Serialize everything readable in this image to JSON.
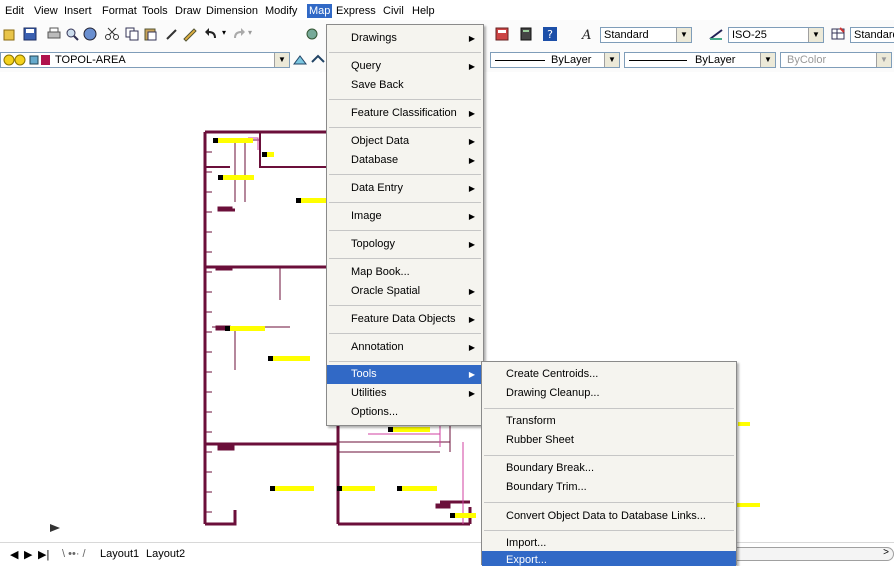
{
  "menubar": {
    "items": [
      {
        "label": "Edit"
      },
      {
        "label": "View"
      },
      {
        "label": "Insert"
      },
      {
        "label": "Format"
      },
      {
        "label": "Tools"
      },
      {
        "label": "Draw"
      },
      {
        "label": "Dimension"
      },
      {
        "label": "Modify"
      },
      {
        "label": "Map"
      },
      {
        "label": "Express"
      },
      {
        "label": "Civil"
      },
      {
        "label": "Help"
      }
    ]
  },
  "toolbar": {
    "text_style": "Standard",
    "dim_style": "ISO-25",
    "table_style": "Standard"
  },
  "layer_toolbar": {
    "current_layer": "TOPOL-AREA",
    "linetype": "ByLayer",
    "lineweight": "ByLayer",
    "plot_style": "ByColor"
  },
  "map_menu": {
    "items": [
      {
        "label": "Drawings",
        "submenu": true
      },
      {
        "label": "Query",
        "submenu": true
      },
      {
        "label": "Save Back",
        "submenu": false
      },
      {
        "label": "Feature Classification",
        "submenu": true
      },
      {
        "label": "Object Data",
        "submenu": true
      },
      {
        "label": "Database",
        "submenu": true
      },
      {
        "label": "Data Entry",
        "submenu": true
      },
      {
        "label": "Image",
        "submenu": true
      },
      {
        "label": "Topology",
        "submenu": true
      },
      {
        "label": "Map Book...",
        "submenu": false
      },
      {
        "label": "Oracle Spatial",
        "submenu": true
      },
      {
        "label": "Feature Data Objects",
        "submenu": true
      },
      {
        "label": "Annotation",
        "submenu": true
      },
      {
        "label": "Tools",
        "submenu": true,
        "highlighted": true
      },
      {
        "label": "Utilities",
        "submenu": true
      },
      {
        "label": "Options...",
        "submenu": false
      }
    ]
  },
  "tools_submenu": {
    "items": [
      {
        "label": "Create Centroids..."
      },
      {
        "label": "Drawing Cleanup..."
      },
      {
        "label": "Transform"
      },
      {
        "label": "Rubber Sheet"
      },
      {
        "label": "Boundary Break..."
      },
      {
        "label": "Boundary Trim..."
      },
      {
        "label": "Convert Object Data to Database Links..."
      },
      {
        "label": "Import..."
      },
      {
        "label": "Export...",
        "highlighted": true
      }
    ]
  },
  "layout_tabs": {
    "tabs": [
      {
        "label": "Layout1"
      },
      {
        "label": "Layout2"
      }
    ]
  },
  "colors": {
    "menu_highlight": "#3169c6",
    "wall": "#6b0f3a",
    "label_fill": "#ffff00"
  }
}
